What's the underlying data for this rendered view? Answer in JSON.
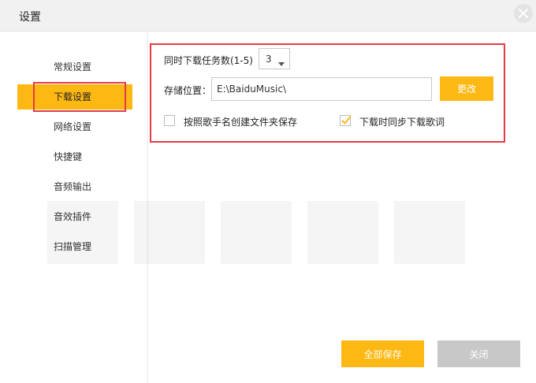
{
  "window": {
    "title": "设置"
  },
  "sidebar": {
    "items": [
      {
        "label": "常规设置",
        "active": false
      },
      {
        "label": "下载设置",
        "active": true
      },
      {
        "label": "网络设置",
        "active": false
      },
      {
        "label": "快捷键",
        "active": false
      },
      {
        "label": "音频输出",
        "active": false
      },
      {
        "label": "音效插件",
        "active": false
      },
      {
        "label": "扫描管理",
        "active": false
      }
    ]
  },
  "download": {
    "concurrent_label": "同时下载任务数(1-5)",
    "concurrent_value": "3",
    "location_label": "存储位置：",
    "location_value": "E:\\BaiduMusic\\",
    "change_button": "更改",
    "option_artist_folder": {
      "label": "按照歌手名创建文件夹保存",
      "checked": false
    },
    "option_sync_lyrics": {
      "label": "下载时同步下载歌词",
      "checked": true
    }
  },
  "footer": {
    "save_all": "全部保存",
    "close": "关闭"
  },
  "colors": {
    "accent": "#fdb813",
    "annotation": "#e43b45",
    "disabled_button": "#c8c8c8"
  }
}
